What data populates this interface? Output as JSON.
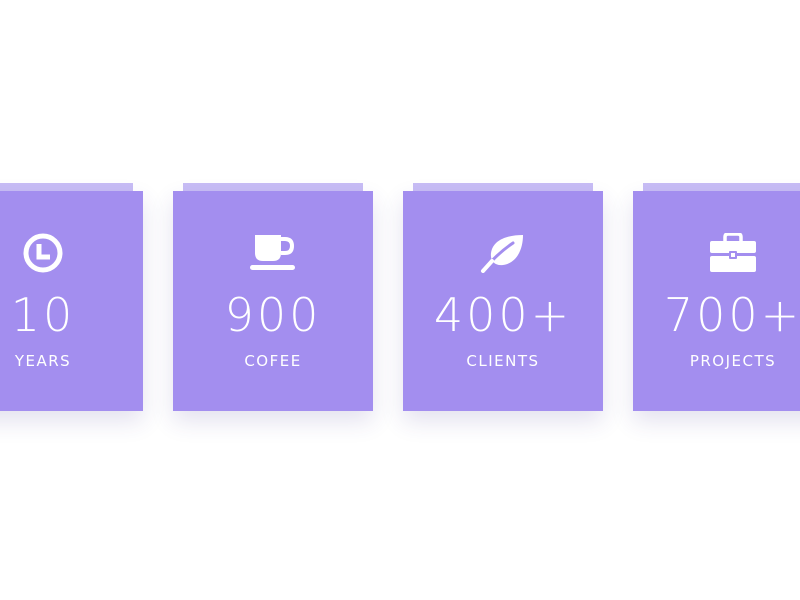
{
  "stats": [
    {
      "icon": "clock-icon",
      "value": "10",
      "label": "YEARS"
    },
    {
      "icon": "coffee-cup-icon",
      "value": "900",
      "label": "COFEE"
    },
    {
      "icon": "leaf-icon",
      "value": "400+",
      "label": "CLIENTS"
    },
    {
      "icon": "briefcase-icon",
      "value": "700+",
      "label": "PROJECTS"
    }
  ],
  "colors": {
    "card_background": "#a38eef",
    "card_tab": "#c8bdf5",
    "text": "#ffffff",
    "page_background": "#ffffff"
  }
}
